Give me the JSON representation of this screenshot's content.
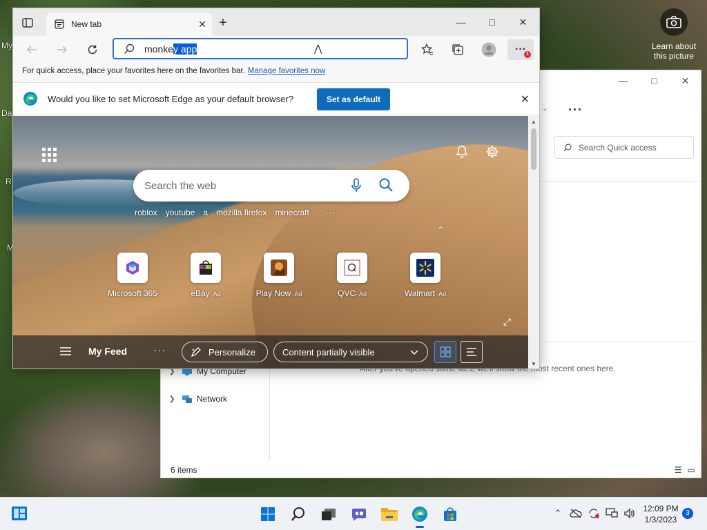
{
  "desktop": {
    "camera_label": "Learn about this picture",
    "icon_fragments": [
      "My",
      "Da",
      "R",
      "M"
    ]
  },
  "explorer": {
    "search_placeholder": "Search Quick access",
    "nav": [
      {
        "label": "My Computer"
      },
      {
        "label": "Network"
      }
    ],
    "recent_message": "After you've opened some files, we'll show the most recent ones here.",
    "status": "6 items",
    "more_dots": "···"
  },
  "edge": {
    "tab_title": "New tab",
    "address_text_plain": "monke",
    "address_text_selected": "y app",
    "favorites_message": "For quick access, place your favorites here on the favorites bar.",
    "manage_favorites": "Manage favorites now",
    "default_prompt": "Would you like to set Microsoft Edge as your default browser?",
    "set_default_button": "Set as default",
    "settings_badge": "1",
    "settings_dots": "···"
  },
  "ntp": {
    "search_placeholder": "Search the web",
    "quick_links": [
      "roblox",
      "youtube",
      "a",
      "mozilla firefox",
      "minecraft"
    ],
    "quick_more": "···",
    "tiles": [
      {
        "label": "Microsoft 365",
        "ad": ""
      },
      {
        "label": "eBay",
        "ad": "· Ad"
      },
      {
        "label": "Play Now",
        "ad": "· Ad"
      },
      {
        "label": "QVC",
        "ad": "· Ad"
      },
      {
        "label": "Walmart",
        "ad": "· Ad"
      }
    ],
    "feed": {
      "title": "My Feed",
      "dots": "···",
      "personalize": "Personalize",
      "content_filter": "Content partially visible"
    }
  },
  "taskbar": {
    "time": "12:09 PM",
    "date": "1/3/2023",
    "notification_count": "3"
  },
  "colors": {
    "accent": "#0f6cbd",
    "selection": "#0a5ad9",
    "badge": "#d13438"
  }
}
